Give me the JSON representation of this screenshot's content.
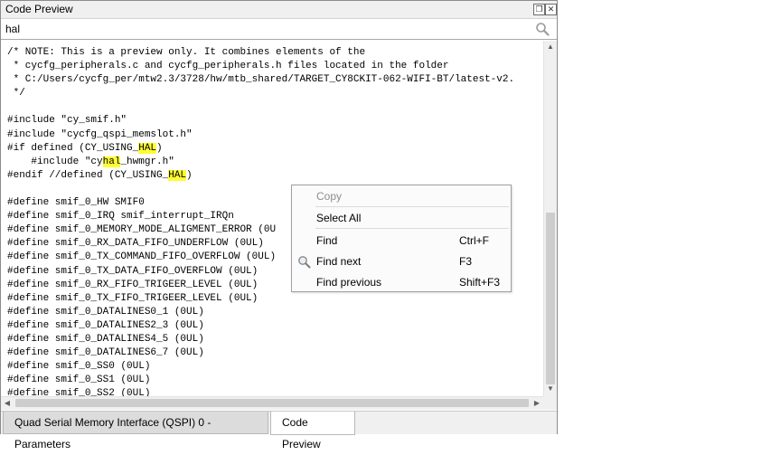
{
  "window": {
    "title": "Code Preview",
    "restore_glyph": "❐",
    "close_glyph": "✕"
  },
  "search": {
    "value": "hal",
    "icon": "search-icon"
  },
  "code": {
    "lines": [
      [
        {
          "t": "/* NOTE: This is a preview only. It combines elements of the"
        }
      ],
      [
        {
          "t": " * cycfg_peripherals.c and cycfg_peripherals.h files located in the folder"
        }
      ],
      [
        {
          "t": " * C:/Users/cycfg_per/mtw2.3/3728/hw/mtb_shared/TARGET_CY8CKIT-062-WIFI-BT/latest-v2."
        }
      ],
      [
        {
          "t": " */"
        }
      ],
      [
        {
          "t": ""
        }
      ],
      [
        {
          "t": "#include \"cy_smif.h\""
        }
      ],
      [
        {
          "t": "#include \"cycfg_qspi_memslot.h\""
        }
      ],
      [
        {
          "t": "#if defined (CY_USING_"
        },
        {
          "t": "HAL",
          "h": true
        },
        {
          "t": ")"
        }
      ],
      [
        {
          "t": "    #include \"cy"
        },
        {
          "t": "hal",
          "h": true
        },
        {
          "t": "_hwmgr.h\""
        }
      ],
      [
        {
          "t": "#endif //defined (CY_USING_"
        },
        {
          "t": "HAL",
          "h": true
        },
        {
          "t": ")"
        }
      ],
      [
        {
          "t": ""
        }
      ],
      [
        {
          "t": "#define smif_0_HW SMIF0"
        }
      ],
      [
        {
          "t": "#define smif_0_IRQ smif_interrupt_IRQn"
        }
      ],
      [
        {
          "t": "#define smif_0_MEMORY_MODE_ALIGMENT_ERROR (0U"
        }
      ],
      [
        {
          "t": "#define smif_0_RX_DATA_FIFO_UNDERFLOW (0UL)"
        }
      ],
      [
        {
          "t": "#define smif_0_TX_COMMAND_FIFO_OVERFLOW (0UL)"
        }
      ],
      [
        {
          "t": "#define smif_0_TX_DATA_FIFO_OVERFLOW (0UL)"
        }
      ],
      [
        {
          "t": "#define smif_0_RX_FIFO_TRIGEER_LEVEL (0UL)"
        }
      ],
      [
        {
          "t": "#define smif_0_TX_FIFO_TRIGEER_LEVEL (0UL)"
        }
      ],
      [
        {
          "t": "#define smif_0_DATALINES0_1 (0UL)"
        }
      ],
      [
        {
          "t": "#define smif_0_DATALINES2_3 (0UL)"
        }
      ],
      [
        {
          "t": "#define smif_0_DATALINES4_5 (0UL)"
        }
      ],
      [
        {
          "t": "#define smif_0_DATALINES6_7 (0UL)"
        }
      ],
      [
        {
          "t": "#define smif_0_SS0 (0UL)"
        }
      ],
      [
        {
          "t": "#define smif_0_SS1 (0UL)"
        }
      ],
      [
        {
          "t": "#define smif_0_SS2 (0UL)"
        }
      ]
    ],
    "highlight_color": "#ffff33"
  },
  "context_menu": {
    "copy": {
      "label": "Copy"
    },
    "select_all": {
      "label": "Select All"
    },
    "find": {
      "label": "Find",
      "shortcut": "Ctrl+F"
    },
    "find_next": {
      "label": "Find next",
      "shortcut": "F3",
      "icon": "magnifier-icon"
    },
    "find_previous": {
      "label": "Find previous",
      "shortcut": "Shift+F3"
    }
  },
  "tabs": [
    {
      "label": "Quad Serial Memory Interface (QSPI) 0 - Parameters",
      "active": false
    },
    {
      "label": "Code Preview",
      "active": true
    }
  ],
  "scroll_glyphs": {
    "up": "▲",
    "down": "▼",
    "left": "◀",
    "right": "▶"
  }
}
